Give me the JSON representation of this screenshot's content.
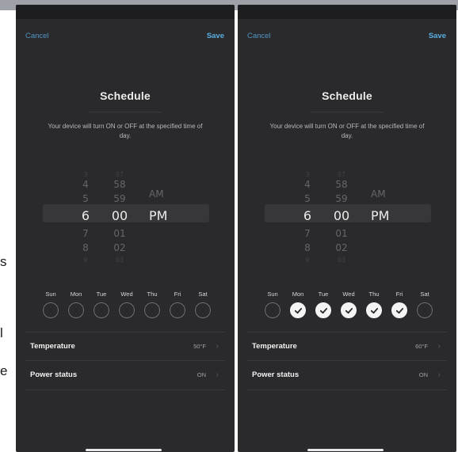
{
  "edge_letters": [
    "s",
    "l",
    "e"
  ],
  "colors": {
    "background": "#2a2a2c",
    "accent": "#58aee0",
    "selected_day": "#f4f4f4",
    "text": "#ececec"
  },
  "screens": [
    {
      "nav": {
        "cancel": "Cancel",
        "save": "Save"
      },
      "title": "Schedule",
      "description": "Your device will turn ON or OFF at the specified time of day.",
      "picker": {
        "hours": [
          "3",
          "4",
          "5",
          "6",
          "7",
          "8",
          "9"
        ],
        "minutes": [
          "57",
          "58",
          "59",
          "00",
          "01",
          "02",
          "03"
        ],
        "ampm": [
          "AM",
          "PM"
        ]
      },
      "days": [
        {
          "label": "Sun",
          "selected": false
        },
        {
          "label": "Mon",
          "selected": false
        },
        {
          "label": "Tue",
          "selected": false
        },
        {
          "label": "Wed",
          "selected": false
        },
        {
          "label": "Thu",
          "selected": false
        },
        {
          "label": "Fri",
          "selected": false
        },
        {
          "label": "Sat",
          "selected": false
        }
      ],
      "settings": [
        {
          "label": "Temperature",
          "value": "50°F",
          "icon": "chevron-right-icon"
        },
        {
          "label": "Power status",
          "value": "ON",
          "icon": "chevron-right-icon"
        }
      ]
    },
    {
      "nav": {
        "cancel": "Cancel",
        "save": "Save"
      },
      "title": "Schedule",
      "description": "Your device will turn ON or OFF at the specified time of day.",
      "picker": {
        "hours": [
          "3",
          "4",
          "5",
          "6",
          "7",
          "8",
          "9"
        ],
        "minutes": [
          "57",
          "58",
          "59",
          "00",
          "01",
          "02",
          "03"
        ],
        "ampm": [
          "AM",
          "PM"
        ]
      },
      "days": [
        {
          "label": "Sun",
          "selected": false
        },
        {
          "label": "Mon",
          "selected": true
        },
        {
          "label": "Tue",
          "selected": true
        },
        {
          "label": "Wed",
          "selected": true
        },
        {
          "label": "Thu",
          "selected": true
        },
        {
          "label": "Fri",
          "selected": true
        },
        {
          "label": "Sat",
          "selected": false
        }
      ],
      "settings": [
        {
          "label": "Temperature",
          "value": "60°F",
          "icon": "chevron-right-icon"
        },
        {
          "label": "Power status",
          "value": "ON",
          "icon": "chevron-right-icon"
        }
      ]
    }
  ]
}
